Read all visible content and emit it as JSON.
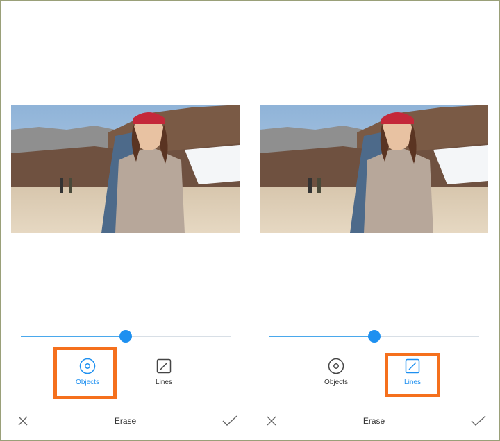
{
  "panels": [
    {
      "slider": {
        "value": 0.5
      },
      "tools": [
        {
          "label": "Objects",
          "active": true
        },
        {
          "label": "Lines",
          "active": false
        }
      ],
      "bottom_bar": {
        "title": "Erase"
      }
    },
    {
      "slider": {
        "value": 0.5
      },
      "tools": [
        {
          "label": "Objects",
          "active": false
        },
        {
          "label": "Lines",
          "active": true
        }
      ],
      "bottom_bar": {
        "title": "Erase"
      }
    }
  ],
  "icons": {
    "objects": "target-circle-icon",
    "lines": "diagonal-line-icon",
    "close": "close-icon",
    "confirm": "checkmark-icon"
  },
  "colors": {
    "accent": "#1e90f0",
    "highlight": "#f5701d",
    "text": "#333333",
    "icon_inactive": "#555555",
    "icon_active": "#1e90f0"
  }
}
